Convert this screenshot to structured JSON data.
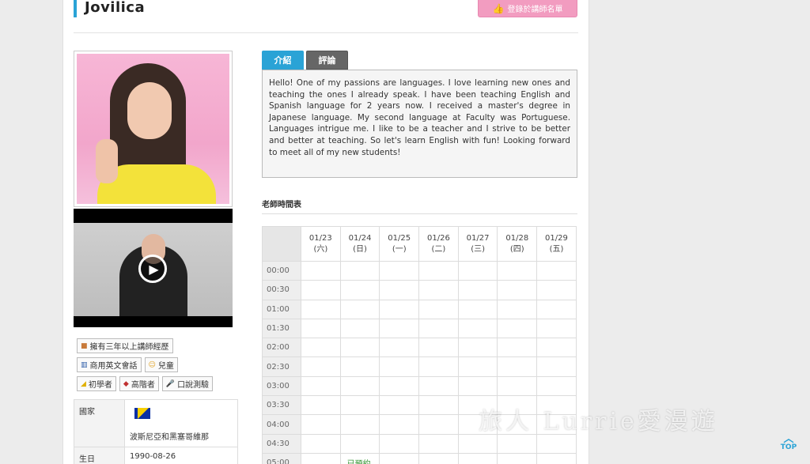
{
  "teacher": {
    "name": "Jovilica"
  },
  "fav_button": {
    "label": "登錄於講師名單",
    "icon": "thumbs-up-icon"
  },
  "tabs": [
    {
      "label": "介紹",
      "active": true
    },
    {
      "label": "評論",
      "active": false
    }
  ],
  "intro_text": "Hello! One of my passions are languages. I love learning new ones and teaching the ones I already speak. I have been teaching English and Spanish language for 2 years now. I received a master's degree in Japanese language. My second language at Faculty was Portuguese. Languages intrigue me. I like to be a teacher and I strive to be better and better at teaching. So let's learn English with fun! Looking forward to meet all of my new students!",
  "tags": [
    {
      "label": "擁有三年以上講師經歷",
      "icon": "box-icon"
    },
    {
      "label": "商用英文會話",
      "icon": "chart-icon"
    },
    {
      "label": "兒童",
      "icon": "smile-icon"
    },
    {
      "label": "初學者",
      "icon": "beginner-icon"
    },
    {
      "label": "高階者",
      "icon": "graduation-icon"
    },
    {
      "label": "口說測驗",
      "icon": "mic-icon"
    }
  ],
  "info": {
    "country_label": "國家",
    "country_value": "波斯尼亞和黑塞哥維那",
    "birth_label": "生日",
    "birth_value": "1990-08-26"
  },
  "schedule": {
    "title": "老師時間表",
    "days": [
      {
        "date": "01/23",
        "weekday": "(六)"
      },
      {
        "date": "01/24",
        "weekday": "(日)"
      },
      {
        "date": "01/25",
        "weekday": "(一)"
      },
      {
        "date": "01/26",
        "weekday": "(二)"
      },
      {
        "date": "01/27",
        "weekday": "(三)"
      },
      {
        "date": "01/28",
        "weekday": "(四)"
      },
      {
        "date": "01/29",
        "weekday": "(五)"
      }
    ],
    "times": [
      "00:00",
      "00:30",
      "01:00",
      "01:30",
      "02:00",
      "02:30",
      "03:00",
      "03:30",
      "04:00",
      "04:30",
      "05:00"
    ],
    "booked_label": "已預約"
  },
  "watermark": "旅人 Lurrie愛漫遊",
  "top_button": {
    "label": "TOP"
  },
  "colors": {
    "accent": "#2aa3d6",
    "fav_pink": "#f29cc0",
    "booked_green": "#3a9a3a"
  }
}
